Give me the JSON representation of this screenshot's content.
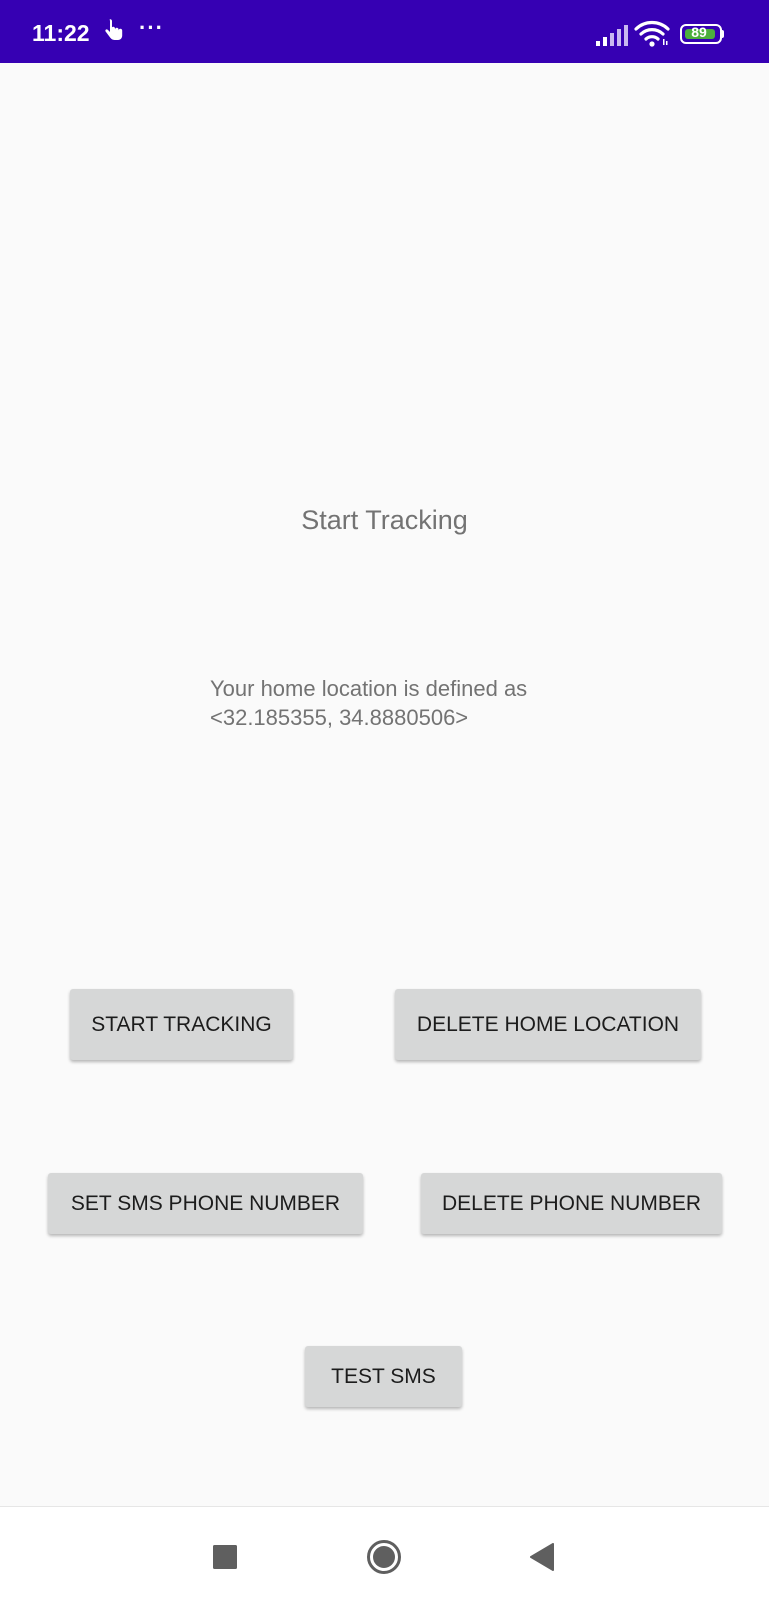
{
  "status_bar": {
    "time": "11:22",
    "more": "···",
    "battery_level": "89",
    "background_color": "#3600b3",
    "icons": [
      "touch-hand-icon",
      "signal-icon",
      "wifi-icon",
      "battery-icon"
    ]
  },
  "main": {
    "title": "Start Tracking",
    "home_location_line1": "Your home location is defined as",
    "home_location_line2": "<32.185355, 34.8880506>"
  },
  "buttons": {
    "start_tracking": "START TRACKING",
    "delete_home_location": "DELETE HOME LOCATION",
    "set_sms_phone_number": "SET SMS PHONE NUMBER",
    "delete_phone_number": "DELETE PHONE NUMBER",
    "test_sms": "TEST SMS",
    "color": "#d6d7d7"
  },
  "nav_bar": {
    "icons": [
      "recents-square-icon",
      "home-circle-icon",
      "back-triangle-icon"
    ]
  }
}
